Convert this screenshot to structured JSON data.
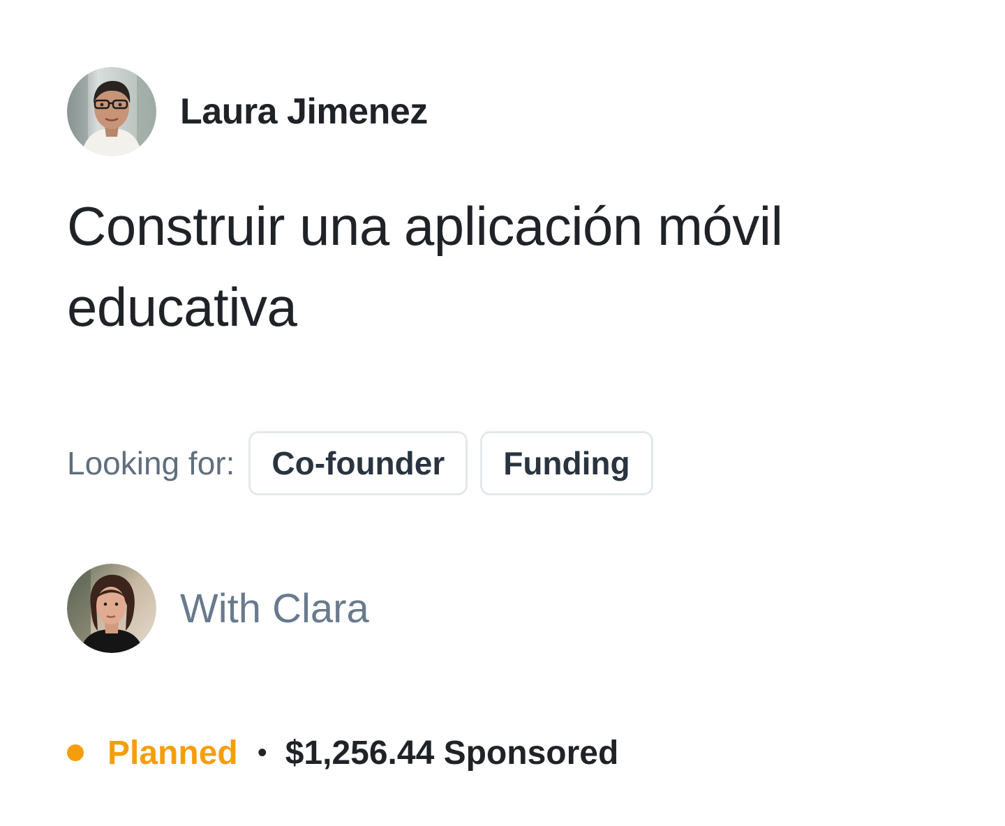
{
  "author": {
    "name": "Laura Jimenez",
    "avatar": "avatar-photo-woman-glasses"
  },
  "project": {
    "title": "Construir una aplicación móvil educativa"
  },
  "looking_for": {
    "label": "Looking for:",
    "tags": [
      "Co-founder",
      "Funding"
    ]
  },
  "collaborator": {
    "text": "With Clara",
    "avatar": "avatar-photo-woman-dark-hair"
  },
  "status": {
    "label": "Planned",
    "color": "#f59e0b",
    "separator": "•",
    "sponsored": "$1,256.44 Sponsored"
  }
}
